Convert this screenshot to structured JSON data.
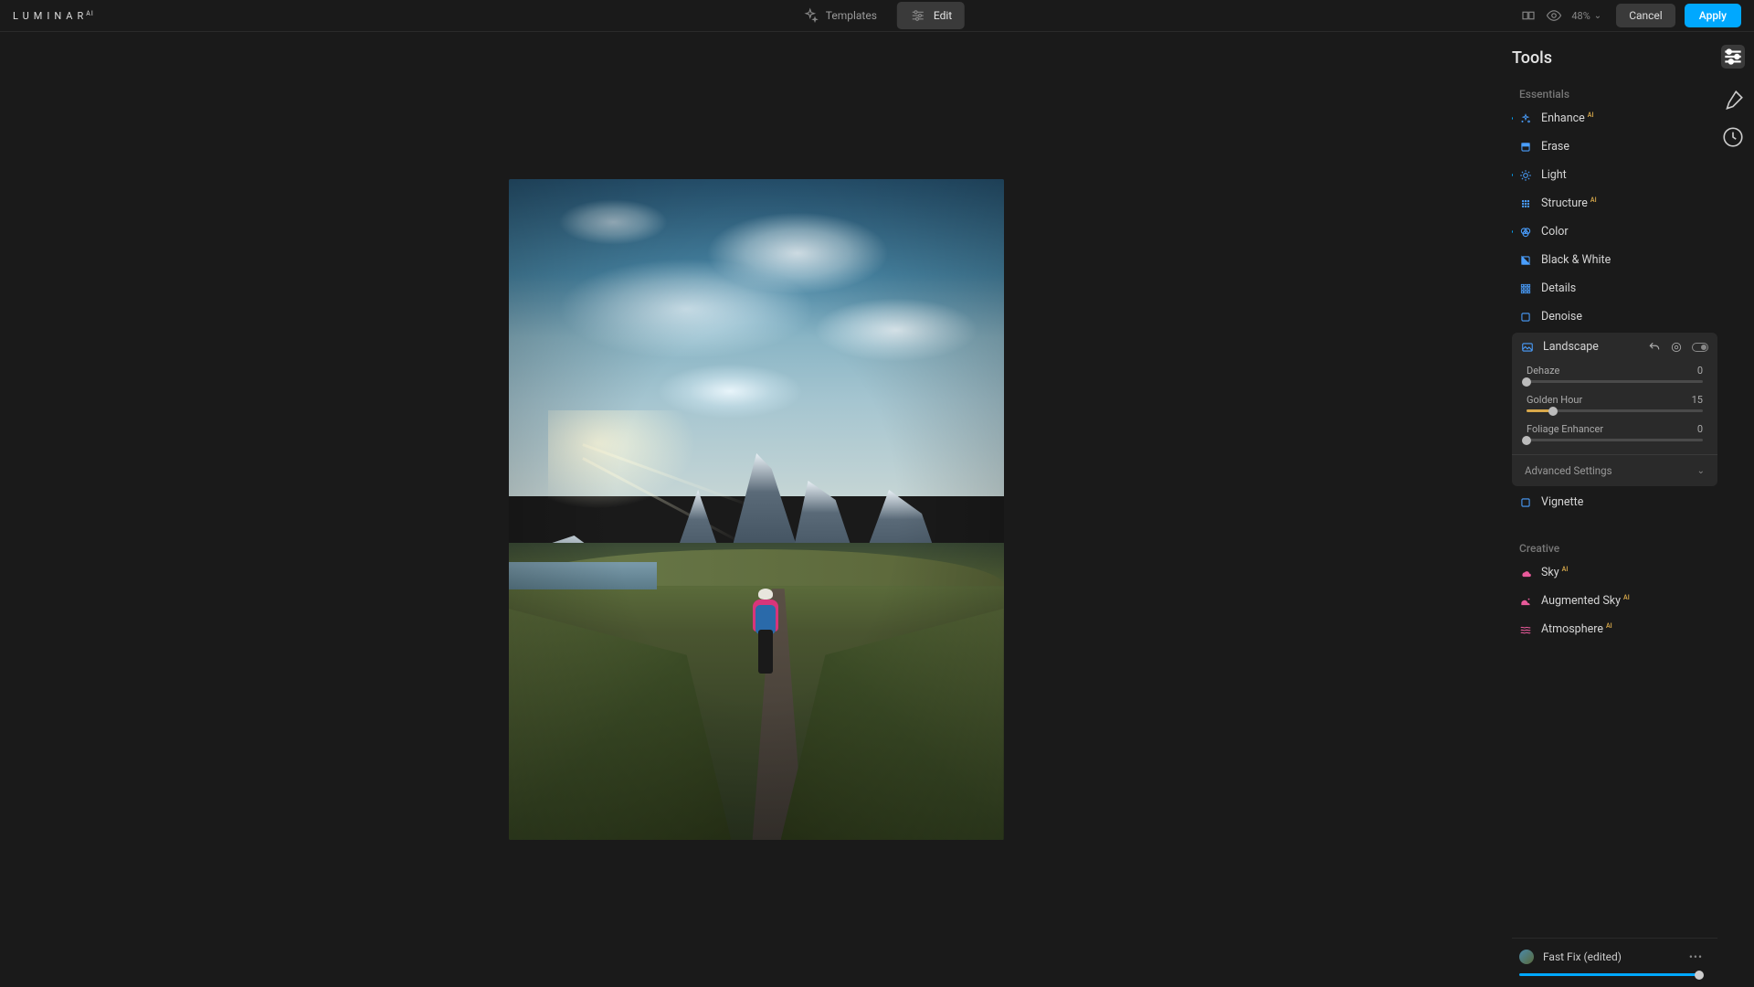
{
  "logo": {
    "brand": "LUMINAR",
    "suffix": "AI"
  },
  "topbar": {
    "templates": "Templates",
    "edit": "Edit",
    "zoom": "48%",
    "cancel": "Cancel",
    "apply": "Apply"
  },
  "panel": {
    "title": "Tools",
    "essentials_label": "Essentials",
    "creative_label": "Creative",
    "ai_badge": "AI"
  },
  "tools_essentials": [
    {
      "name": "Enhance",
      "ai": true,
      "modified": true,
      "icon": "enhance"
    },
    {
      "name": "Erase",
      "ai": false,
      "modified": false,
      "icon": "erase"
    },
    {
      "name": "Light",
      "ai": false,
      "modified": true,
      "icon": "light"
    },
    {
      "name": "Structure",
      "ai": true,
      "modified": false,
      "icon": "structure"
    },
    {
      "name": "Color",
      "ai": false,
      "modified": true,
      "icon": "color"
    },
    {
      "name": "Black & White",
      "ai": false,
      "modified": false,
      "icon": "bw"
    },
    {
      "name": "Details",
      "ai": false,
      "modified": false,
      "icon": "details"
    },
    {
      "name": "Denoise",
      "ai": false,
      "modified": false,
      "icon": "denoise"
    }
  ],
  "landscape": {
    "label": "Landscape",
    "sliders": [
      {
        "label": "Dehaze",
        "value": 0,
        "min": 0,
        "max": 100,
        "fill": "#d9a84a"
      },
      {
        "label": "Golden Hour",
        "value": 15,
        "min": 0,
        "max": 100,
        "fill": "#d9a84a"
      },
      {
        "label": "Foliage Enhancer",
        "value": 0,
        "min": 0,
        "max": 100,
        "fill": "#6aaa4a"
      }
    ],
    "advanced": "Advanced Settings"
  },
  "tools_after_landscape": [
    {
      "name": "Vignette",
      "ai": false,
      "modified": false,
      "icon": "vignette"
    }
  ],
  "tools_creative": [
    {
      "name": "Sky",
      "ai": true,
      "modified": false,
      "icon": "sky"
    },
    {
      "name": "Augmented Sky",
      "ai": true,
      "modified": false,
      "icon": "augsky"
    },
    {
      "name": "Atmosphere",
      "ai": true,
      "modified": false,
      "icon": "atmosphere"
    }
  ],
  "preset": {
    "name": "Fast Fix (edited)",
    "amount": 98
  }
}
